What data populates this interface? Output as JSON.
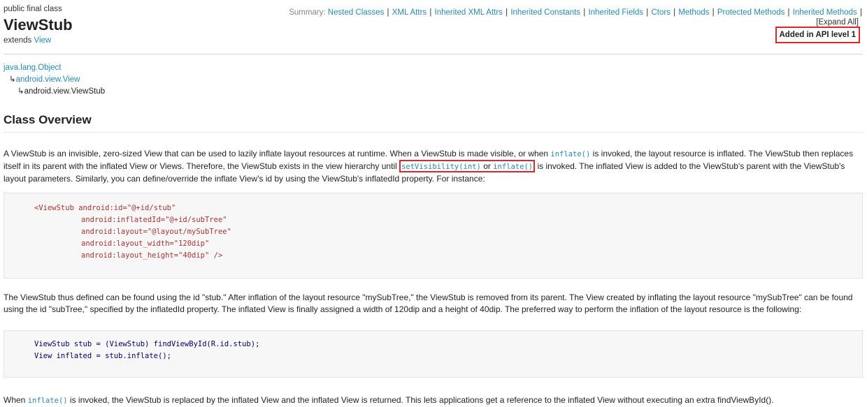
{
  "header": {
    "modifiers": "public final class",
    "class_name": "ViewStub",
    "extends_label": "extends",
    "extends_link": "View"
  },
  "summary": {
    "label": "Summary:",
    "links": [
      "Nested Classes",
      "XML Attrs",
      "Inherited XML Attrs",
      "Inherited Constants",
      "Inherited Fields",
      "Ctors",
      "Methods",
      "Protected Methods",
      "Inherited Methods"
    ],
    "expand_all": "[Expand All]",
    "api_level": "Added in API level 1"
  },
  "inheritance": {
    "root": "java.lang.Object",
    "parent": "android.view.View",
    "current": "android.view.ViewStub"
  },
  "overview_title": "Class Overview",
  "para1": {
    "t1": "A ViewStub is an invisible, zero-sized View that can be used to lazily inflate layout resources at runtime. When a ViewStub is made visible, or when ",
    "c1": "inflate()",
    "t2": " is invoked, the layout resource is inflated. The ViewStub then replaces itself in its parent with the inflated View or Views. Therefore, the ViewStub exists in the view hierarchy until ",
    "c2": "setVisibility(int)",
    "or": " or ",
    "c3": "inflate()",
    "t3": " is invoked. The inflated View is added to the ViewStub's parent with the ViewStub's layout parameters. Similarly, you can define/override the inflate View's id by using the ViewStub's inflatedId property. For instance:"
  },
  "code1": {
    "line1_tag": "<ViewStub",
    "line1_attr": " android:id=\"@+id/stub\"",
    "line2": "android:inflatedId=\"@+id/subTree\"",
    "line3": "android:layout=\"@layout/mySubTree\"",
    "line4": "android:layout_width=\"120dip\"",
    "line5": "android:layout_height=\"40dip\" />"
  },
  "para2": "The ViewStub thus defined can be found using the id \"stub.\" After inflation of the layout resource \"mySubTree,\" the ViewStub is removed from its parent. The View created by inflating the layout resource \"mySubTree\" can be found using the id \"subTree,\" specified by the inflatedId property. The inflated View is finally assigned a width of 120dip and a height of 40dip. The preferred way to perform the inflation of the layout resource is the following:",
  "code2": {
    "line1": "ViewStub stub = (ViewStub) findViewById(R.id.stub);",
    "line2": "View inflated = stub.inflate();"
  },
  "para3": {
    "t1": "When ",
    "c1": "inflate()",
    "t2": " is invoked, the ViewStub is replaced by the inflated View and the inflated View is returned. This lets applications get a reference to the inflated View without executing an extra findViewById()."
  },
  "colors": {
    "link": "#258aaf",
    "highlight_border": "#e0262a",
    "code_bg": "#f7f7f7"
  }
}
